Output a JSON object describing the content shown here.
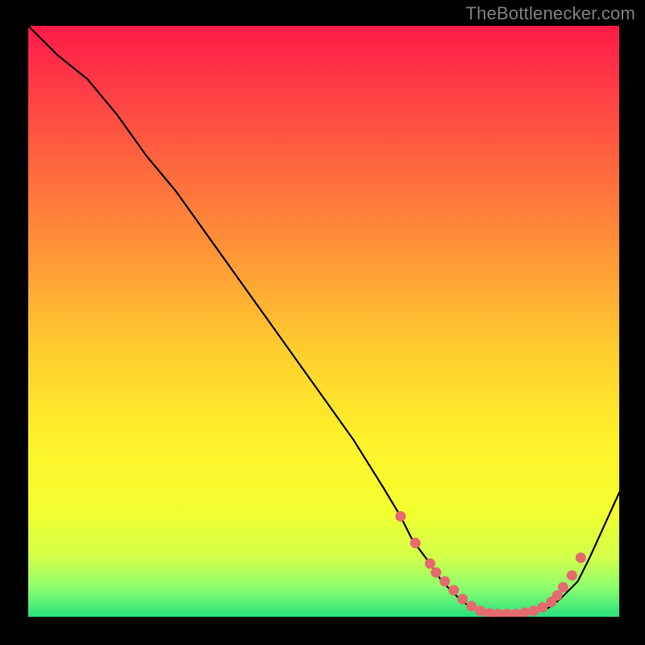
{
  "attribution": "TheBottlenecker.com",
  "colors": {
    "page_bg": "#000000",
    "attribution_text": "#7f7f7f",
    "curve": "#000000",
    "marker_fill": "#e56a6d",
    "marker_stroke": "#c94a50",
    "gradient_stops": [
      {
        "offset": 0.0,
        "color": "#ff1a48"
      },
      {
        "offset": 0.1,
        "color": "#ff3b46"
      },
      {
        "offset": 0.25,
        "color": "#ff6b3e"
      },
      {
        "offset": 0.4,
        "color": "#ff9a36"
      },
      {
        "offset": 0.55,
        "color": "#ffce2e"
      },
      {
        "offset": 0.7,
        "color": "#fff22a"
      },
      {
        "offset": 0.82,
        "color": "#f3ff2e"
      },
      {
        "offset": 0.9,
        "color": "#d2ff4a"
      },
      {
        "offset": 0.95,
        "color": "#8eff6e"
      },
      {
        "offset": 1.0,
        "color": "#28e07e"
      }
    ]
  },
  "chart_data": {
    "type": "line",
    "title": "",
    "xlabel": "",
    "ylabel": "",
    "xlim": [
      0,
      100
    ],
    "ylim": [
      0,
      100
    ],
    "grid": false,
    "legend": false,
    "x": [
      0,
      5,
      10,
      15,
      20,
      25,
      30,
      35,
      40,
      45,
      50,
      55,
      60,
      63,
      65,
      68,
      70,
      73,
      75,
      78,
      80,
      83,
      85,
      88,
      90,
      93,
      95,
      100
    ],
    "y": [
      100,
      95,
      91,
      85,
      78,
      72,
      65,
      58,
      51,
      44,
      37,
      30,
      22,
      17,
      13,
      9,
      6,
      3,
      1.5,
      0.8,
      0.5,
      0.5,
      0.8,
      1.5,
      3,
      6,
      10,
      21
    ],
    "markers": {
      "x": [
        63,
        65.5,
        68,
        69,
        70.5,
        72,
        73.5,
        75,
        76.5,
        78,
        79.5,
        81,
        82.5,
        84,
        85.5,
        87,
        88.5,
        89.5,
        90.5,
        92,
        93.5
      ],
      "y": [
        17,
        12.5,
        9,
        7.5,
        6,
        4.5,
        3,
        1.8,
        1.0,
        0.6,
        0.5,
        0.5,
        0.5,
        0.7,
        1.0,
        1.6,
        2.5,
        3.6,
        5.0,
        7.0,
        10.0
      ]
    }
  }
}
